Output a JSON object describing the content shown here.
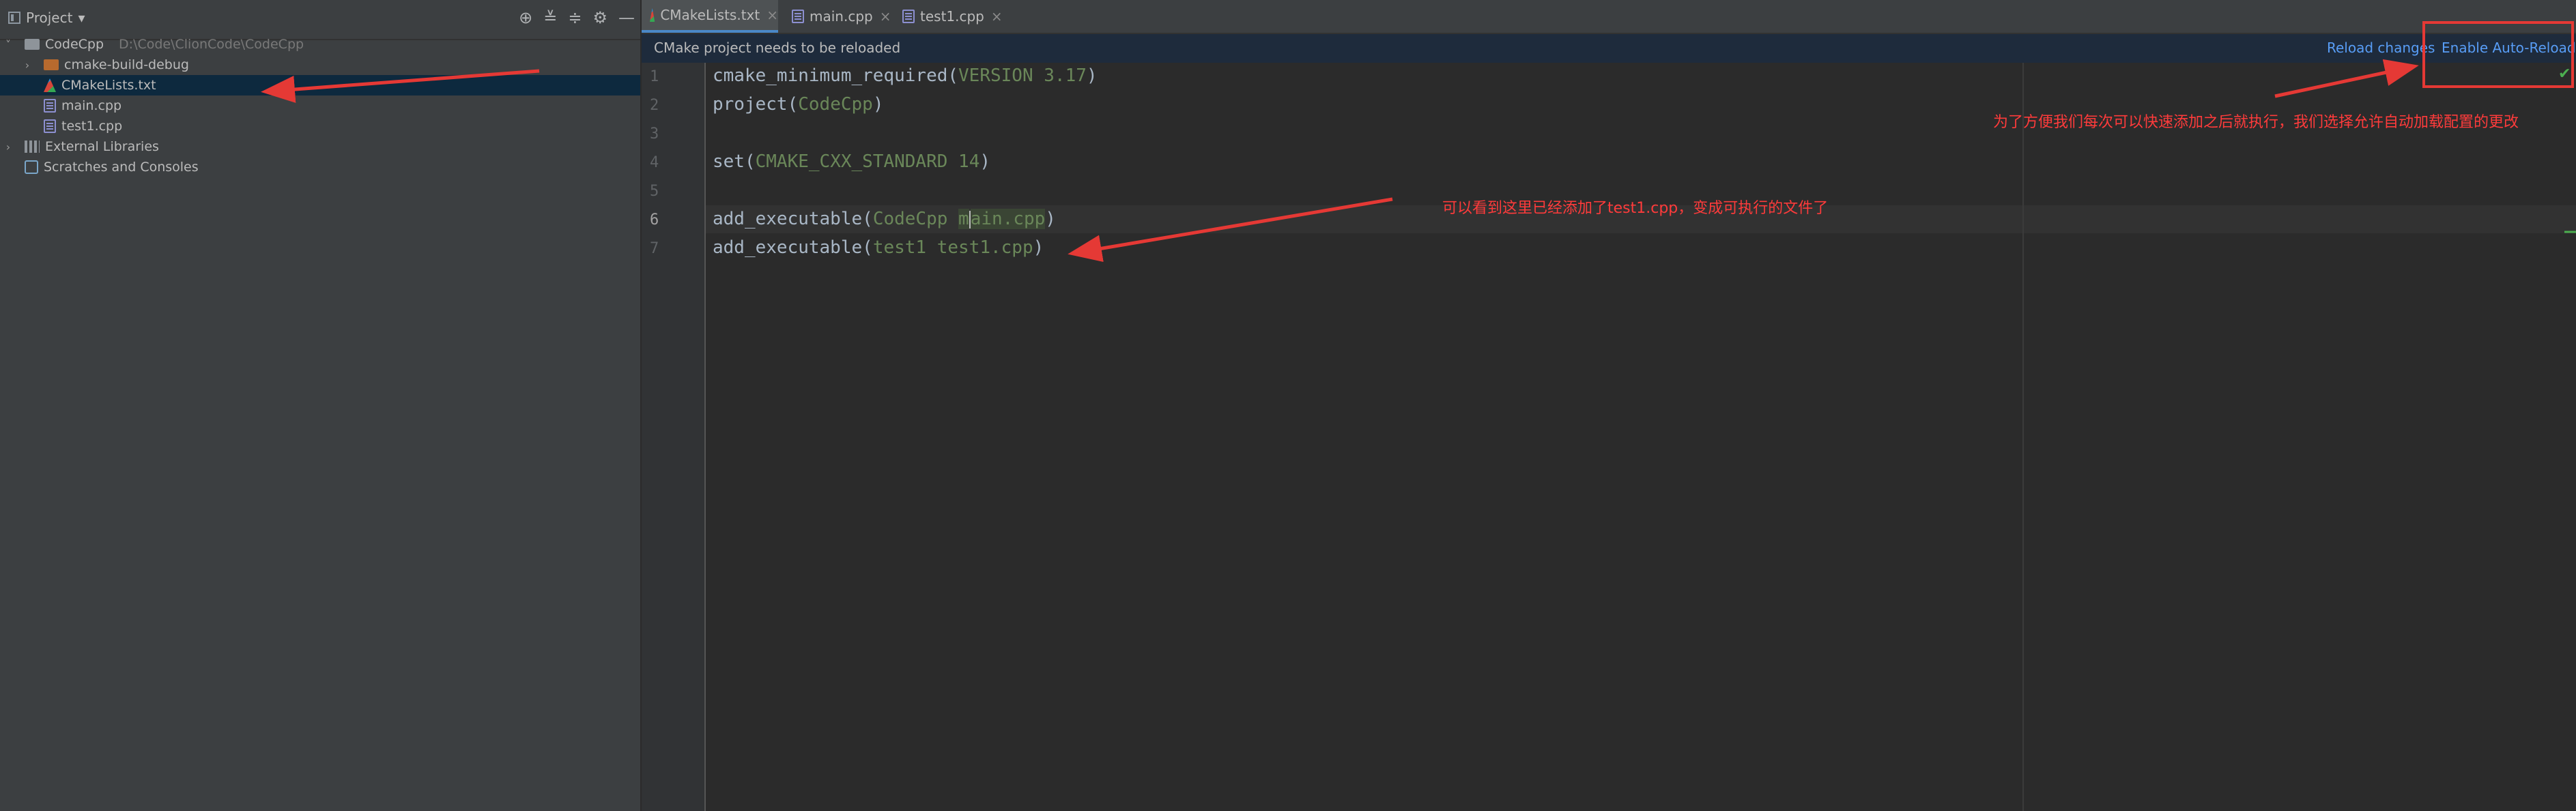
{
  "project_panel": {
    "title": "Project",
    "dropdown_glyph": "▾",
    "tools": [
      "⊕",
      "≚",
      "≑",
      "⚙",
      "—"
    ],
    "tree": [
      {
        "label": "CodeCpp",
        "path": "D:\\Code\\ClionCode\\CodeCpp",
        "icon": "folder-icon",
        "expanded": "˅"
      },
      {
        "label": "cmake-build-debug",
        "icon": "folder-icon",
        "expanded": "›"
      },
      {
        "label": "CMakeLists.txt",
        "icon": "cmake-file-icon"
      },
      {
        "label": "main.cpp",
        "icon": "cpp-file-icon"
      },
      {
        "label": "test1.cpp",
        "icon": "cpp-file-icon"
      },
      {
        "label": "External Libraries",
        "icon": "library-icon",
        "expanded": "›"
      },
      {
        "label": "Scratches and Consoles",
        "icon": "scratch-icon"
      }
    ]
  },
  "tabs": [
    {
      "label": "CMakeLists.txt",
      "close": "×"
    },
    {
      "label": "main.cpp",
      "close": "×"
    },
    {
      "label": "test1.cpp",
      "close": "×"
    }
  ],
  "notification": {
    "message": "CMake project needs to be reloaded",
    "reload_changes": "Reload changes",
    "enable_auto_reload": "Enable Auto-Reload",
    "check": "✔"
  },
  "editor": {
    "line_numbers": [
      "1",
      "2",
      "3",
      "4",
      "5",
      "6",
      "7"
    ],
    "lines": [
      {
        "fn": "cmake_minimum_required(",
        "arg": "VERSION 3.17",
        "end": ")"
      },
      {
        "fn": "project(",
        "arg": "CodeCpp",
        "end": ")"
      },
      {
        "fn": "",
        "arg": "",
        "end": ""
      },
      {
        "fn": "set(",
        "arg": "CMAKE_CXX_STANDARD 14",
        "end": ")"
      },
      {
        "fn": "",
        "arg": "",
        "end": ""
      },
      {
        "fn": "add_executable(",
        "arg_a": "CodeCpp ",
        "arg_b": "m",
        "arg_c": "ain.cpp",
        "end": ")"
      },
      {
        "fn": "add_executable(",
        "arg": "test1 test1.cpp",
        "end": ")"
      }
    ]
  },
  "annotations": {
    "auto_reload_note": "为了方便我们每次可以快速添加之后就执行，我们选择允许自动加载配置的更改",
    "added_note": "可以看到这里已经添加了test1.cpp，变成可执行的文件了"
  },
  "colors": {
    "accent": "#4a88c7",
    "link": "#589df6",
    "annotation": "#ff3b3b",
    "string_arg": "#6a8759"
  }
}
